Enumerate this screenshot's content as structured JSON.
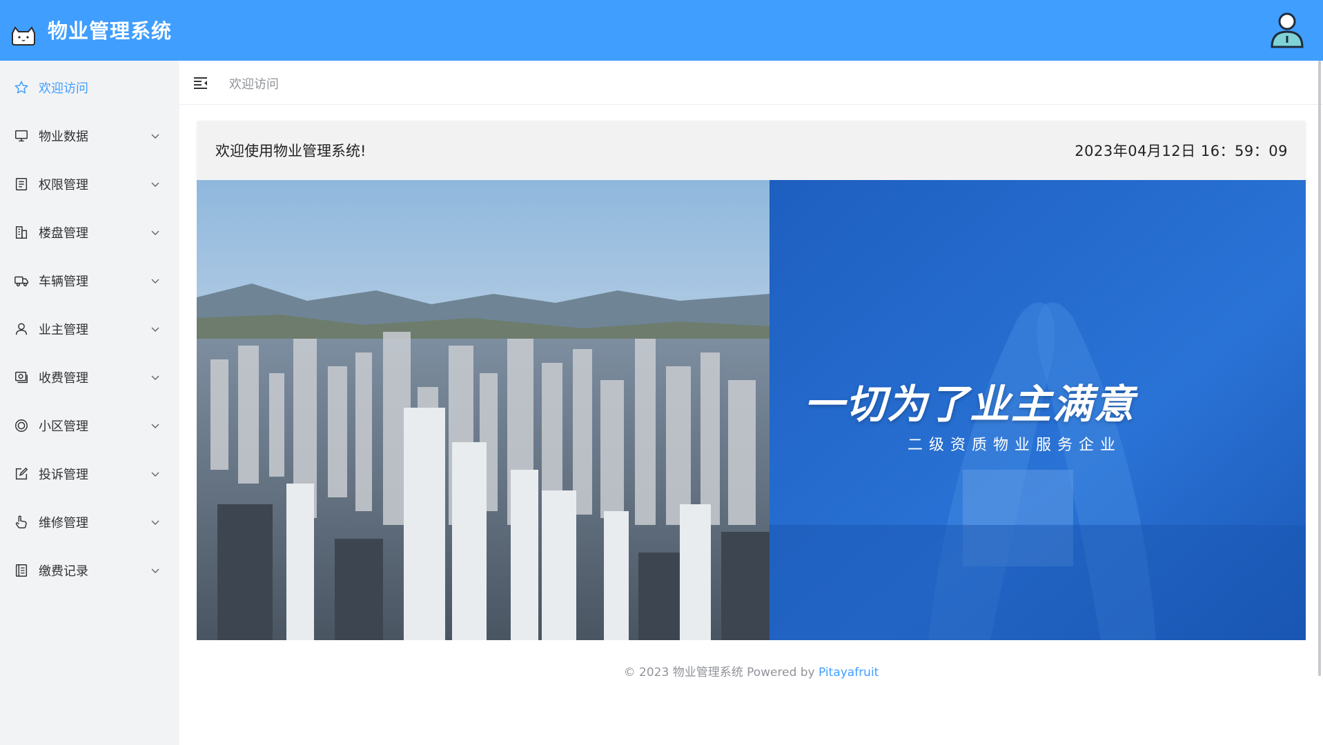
{
  "header": {
    "title": "物业管理系统",
    "logo_icon": "cat-logo-icon",
    "avatar_icon": "user-avatar-icon",
    "accent": "#409eff"
  },
  "sidebar": {
    "items": [
      {
        "label": "欢迎访问",
        "icon": "star-icon",
        "active": true
      },
      {
        "label": "物业数据",
        "icon": "monitor-icon"
      },
      {
        "label": "权限管理",
        "icon": "document-icon"
      },
      {
        "label": "楼盘管理",
        "icon": "building-icon"
      },
      {
        "label": "车辆管理",
        "icon": "truck-icon"
      },
      {
        "label": "业主管理",
        "icon": "user-icon"
      },
      {
        "label": "收费管理",
        "icon": "cash-icon"
      },
      {
        "label": "小区管理",
        "icon": "circle-icon"
      },
      {
        "label": "投诉管理",
        "icon": "edit-icon"
      },
      {
        "label": "维修管理",
        "icon": "hand-icon"
      },
      {
        "label": "缴费记录",
        "icon": "notebook-icon"
      }
    ]
  },
  "topbar": {
    "breadcrumb": "欢迎访问",
    "fold_icon": "fold-menu-icon"
  },
  "main": {
    "welcome": "欢迎使用物业管理系统!",
    "datetime": "2023年04月12日 16：59：09",
    "banner": {
      "slogan": "一切为了业主满意",
      "subslogan": "二级资质物业服务企业"
    }
  },
  "footer": {
    "text": "© 2023 物业管理系统 Powered by ",
    "brand": "Pitayafruit"
  }
}
